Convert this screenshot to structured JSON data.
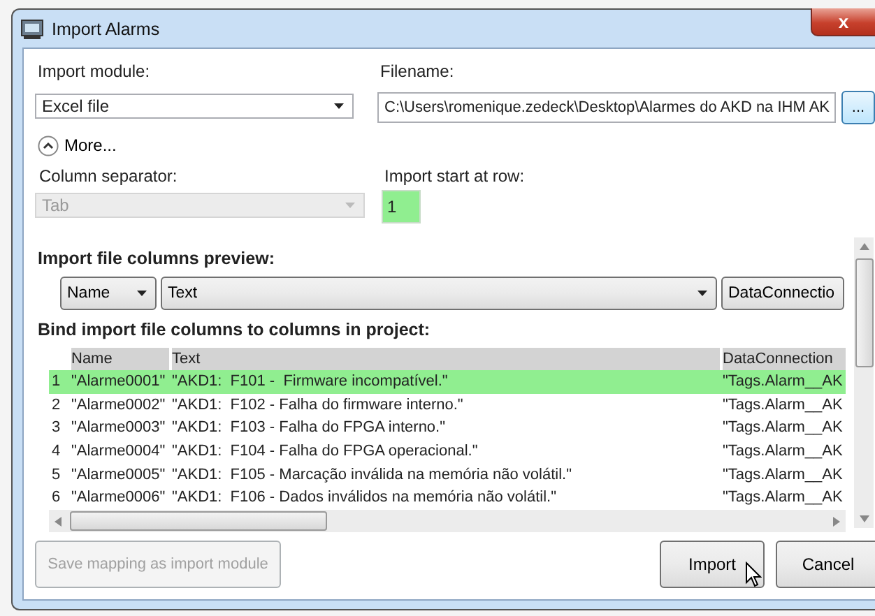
{
  "window": {
    "title": "Import Alarms",
    "close_label": "x"
  },
  "import_module": {
    "label": "Import module:",
    "value": "Excel file"
  },
  "filename": {
    "label": "Filename:",
    "value": "C:\\Users\\romenique.zedeck\\Desktop\\Alarmes do AKD na IHM AK",
    "browse_label": "..."
  },
  "more_toggle": {
    "label": "More...",
    "expanded": true
  },
  "column_separator": {
    "label": "Column separator:",
    "value": "Tab",
    "disabled": true
  },
  "start_row": {
    "label": "Import start at row:",
    "value": "1"
  },
  "preview": {
    "heading": "Import file columns preview:",
    "columns": [
      {
        "label": "Name",
        "caret_shown": true
      },
      {
        "label": "Text",
        "caret_shown": true
      },
      {
        "label": "DataConnectio",
        "caret_shown": false
      }
    ]
  },
  "bind": {
    "heading": "Bind import file columns to columns in project:",
    "columns": [
      "Name",
      "Text",
      "DataConnection"
    ],
    "rows": [
      {
        "number": "1",
        "name": "\"Alarme0001\"",
        "text": "\"AKD1:  F101 -  Firmware incompatível.\"",
        "data_connection": "\"Tags.Alarm__AK",
        "selected": true
      },
      {
        "number": "2",
        "name": "\"Alarme0002\"",
        "text": "\"AKD1:  F102 - Falha do firmware interno.\"",
        "data_connection": "\"Tags.Alarm__AK",
        "selected": false
      },
      {
        "number": "3",
        "name": "\"Alarme0003\"",
        "text": "\"AKD1:  F103 - Falha do FPGA interno.\"",
        "data_connection": "\"Tags.Alarm__AK",
        "selected": false
      },
      {
        "number": "4",
        "name": "\"Alarme0004\"",
        "text": "\"AKD1:  F104 - Falha do FPGA operacional.\"",
        "data_connection": "\"Tags.Alarm__AK",
        "selected": false
      },
      {
        "number": "5",
        "name": "\"Alarme0005\"",
        "text": "\"AKD1:  F105 - Marcação inválida na memória não volátil.\"",
        "data_connection": "\"Tags.Alarm__AK",
        "selected": false
      },
      {
        "number": "6",
        "name": "\"Alarme0006\"",
        "text": "\"AKD1:  F106 - Dados inválidos na memória não volátil.\"",
        "data_connection": "\"Tags.Alarm__AK",
        "selected": false
      }
    ]
  },
  "buttons": [
    {
      "kind": "save",
      "label": "Save mapping as import module",
      "disabled": true
    },
    {
      "kind": "import",
      "label": "Import",
      "disabled": false
    },
    {
      "kind": "cancel",
      "label": "Cancel",
      "disabled": false
    }
  ]
}
